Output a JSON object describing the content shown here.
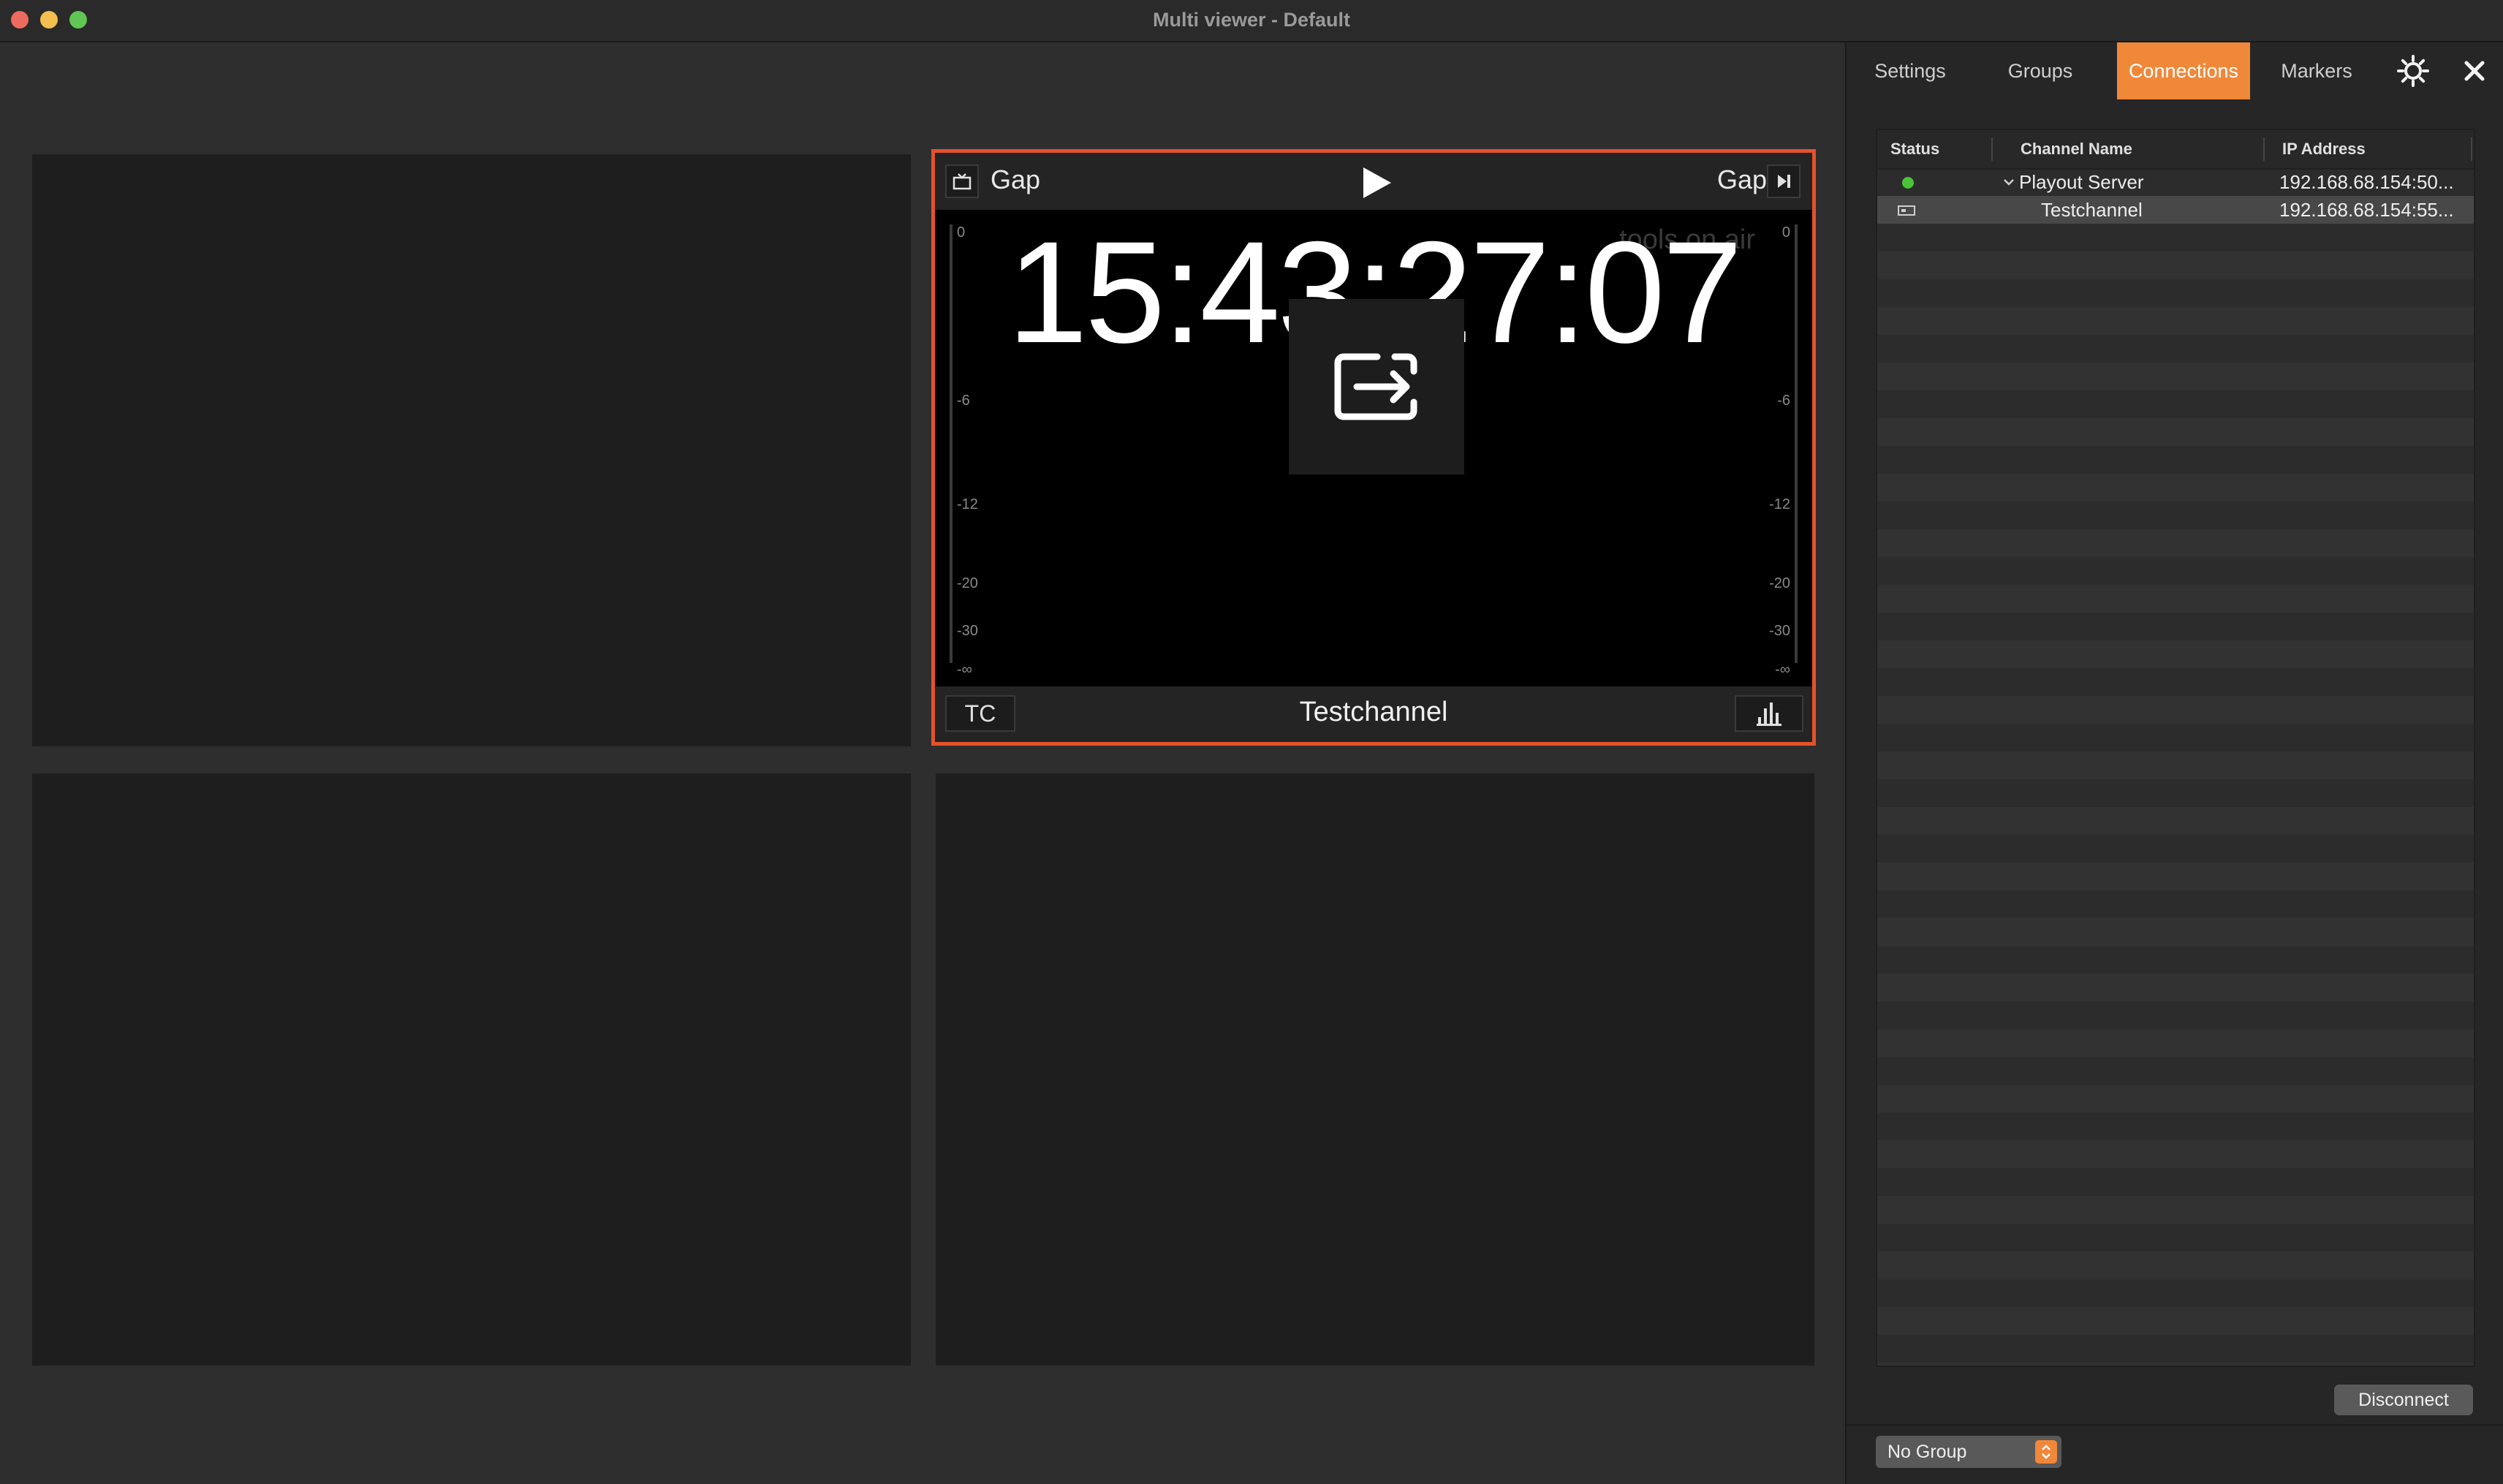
{
  "window": {
    "title": "Multi viewer - Default"
  },
  "channel": {
    "header_left_label": "Gap",
    "header_right_label": "Gap",
    "timecode": "15:43:27:07",
    "watermark": "tools on air",
    "tc_button": "TC",
    "name": "Testchannel",
    "meter_ticks": [
      "0",
      "-6",
      "-12",
      "-20",
      "-30",
      "-∞"
    ]
  },
  "panel": {
    "tabs": [
      {
        "label": "Settings",
        "active": false
      },
      {
        "label": "Groups",
        "active": false
      },
      {
        "label": "Connections",
        "active": true
      },
      {
        "label": "Markers",
        "active": false
      }
    ],
    "table": {
      "columns": [
        "Status",
        "Channel Name",
        "IP Address"
      ],
      "rows": [
        {
          "status": "online",
          "name": "Playout Server",
          "ip": "192.168.68.154:50...",
          "expanded": true
        },
        {
          "status": "channel",
          "name": "Testchannel",
          "ip": "192.168.68.154:55...",
          "selected": true
        }
      ]
    },
    "disconnect_label": "Disconnect",
    "group_select": "No Group"
  },
  "colors": {
    "accent": "#f0883a",
    "active_border": "#e5522a",
    "status_online": "#49c436"
  }
}
